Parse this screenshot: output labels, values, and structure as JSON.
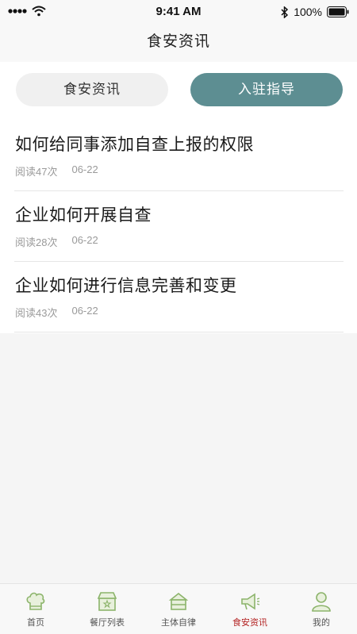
{
  "status_bar": {
    "time": "9:41 AM",
    "battery": "100%"
  },
  "nav": {
    "title": "食安资讯"
  },
  "tabs": [
    {
      "label": "食安资讯",
      "active": false
    },
    {
      "label": "入驻指导",
      "active": true
    }
  ],
  "articles": [
    {
      "title": "如何给同事添加自查上报的权限",
      "reads": "阅读47次",
      "date": "06-22"
    },
    {
      "title": "企业如何开展自查",
      "reads": "阅读28次",
      "date": "06-22"
    },
    {
      "title": "企业如何进行信息完善和变更",
      "reads": "阅读43次",
      "date": "06-22"
    }
  ],
  "tab_bar": {
    "items": [
      {
        "label": "首页",
        "icon": "chef-hat-icon"
      },
      {
        "label": "餐厅列表",
        "icon": "shop-icon"
      },
      {
        "label": "主体自律",
        "icon": "building-icon"
      },
      {
        "label": "食安资讯",
        "icon": "megaphone-icon",
        "active": true
      },
      {
        "label": "我的",
        "icon": "user-icon"
      }
    ]
  },
  "colors": {
    "accent": "#5d8e92",
    "icon_green": "#8cb46b",
    "active_label": "#b21f1f"
  }
}
